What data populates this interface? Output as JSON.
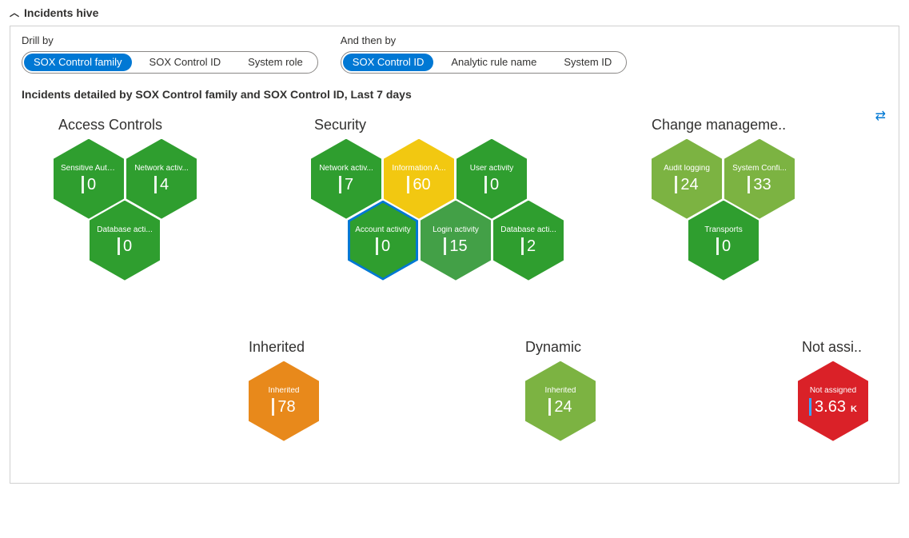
{
  "header": {
    "title": "Incidents hive"
  },
  "drill": {
    "by_label": "Drill by",
    "then_label": "And then by",
    "by_options": [
      {
        "label": "SOX Control family",
        "selected": true
      },
      {
        "label": "SOX Control ID",
        "selected": false
      },
      {
        "label": "System role",
        "selected": false
      }
    ],
    "then_options": [
      {
        "label": "SOX Control ID",
        "selected": true
      },
      {
        "label": "Analytic rule name",
        "selected": false
      },
      {
        "label": "System ID",
        "selected": false
      }
    ]
  },
  "subtitle": "Incidents detailed by SOX Control family and SOX Control ID, Last 7 days",
  "clusters": {
    "access": {
      "title": "Access Controls",
      "cells": [
        {
          "label": "Sensitive Auth...",
          "value": "0"
        },
        {
          "label": "Network activ...",
          "value": "4"
        },
        {
          "label": "Database acti...",
          "value": "0"
        }
      ]
    },
    "security": {
      "title": "Security",
      "cells": [
        {
          "label": "Network activ...",
          "value": "7"
        },
        {
          "label": "Information A...",
          "value": "60"
        },
        {
          "label": "User activity",
          "value": "0"
        },
        {
          "label": "Account activity",
          "value": "0"
        },
        {
          "label": "Login activity",
          "value": "15"
        },
        {
          "label": "Database acti...",
          "value": "2"
        }
      ]
    },
    "change": {
      "title": "Change manageme..",
      "cells": [
        {
          "label": "Audit logging",
          "value": "24"
        },
        {
          "label": "System Confi...",
          "value": "33"
        },
        {
          "label": "Transports",
          "value": "0"
        }
      ]
    },
    "inherited": {
      "title": "Inherited",
      "cells": [
        {
          "label": "Inherited",
          "value": "78"
        }
      ]
    },
    "dynamic": {
      "title": "Dynamic",
      "cells": [
        {
          "label": "Inherited",
          "value": "24"
        }
      ]
    },
    "notassigned": {
      "title": "Not assi..",
      "cells": [
        {
          "label": "Not assigned",
          "value": "3.63",
          "unit": "K"
        }
      ]
    }
  },
  "chart_data": {
    "type": "table",
    "title": "Incidents detailed by SOX Control family and SOX Control ID, Last 7 days",
    "groups": [
      {
        "family": "Access Controls",
        "items": [
          {
            "control_id": "Sensitive Auth...",
            "count": 0
          },
          {
            "control_id": "Network activ...",
            "count": 4
          },
          {
            "control_id": "Database acti...",
            "count": 0
          }
        ]
      },
      {
        "family": "Security",
        "items": [
          {
            "control_id": "Network activ...",
            "count": 7
          },
          {
            "control_id": "Information A...",
            "count": 60
          },
          {
            "control_id": "User activity",
            "count": 0
          },
          {
            "control_id": "Account activity",
            "count": 0
          },
          {
            "control_id": "Login activity",
            "count": 15
          },
          {
            "control_id": "Database acti...",
            "count": 2
          }
        ]
      },
      {
        "family": "Change management",
        "items": [
          {
            "control_id": "Audit logging",
            "count": 24
          },
          {
            "control_id": "System Confi...",
            "count": 33
          },
          {
            "control_id": "Transports",
            "count": 0
          }
        ]
      },
      {
        "family": "Inherited",
        "items": [
          {
            "control_id": "Inherited",
            "count": 78
          }
        ]
      },
      {
        "family": "Dynamic",
        "items": [
          {
            "control_id": "Inherited",
            "count": 24
          }
        ]
      },
      {
        "family": "Not assigned",
        "items": [
          {
            "control_id": "Not assigned",
            "count": 3630
          }
        ]
      }
    ]
  }
}
